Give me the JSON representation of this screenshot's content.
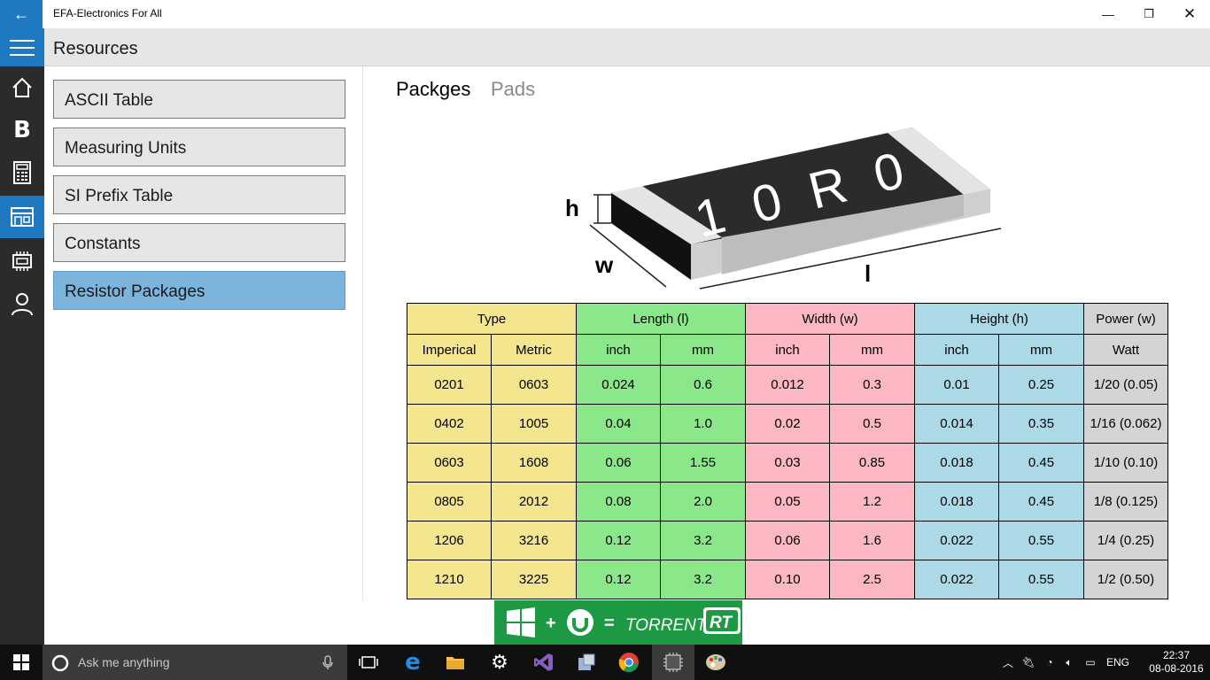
{
  "window": {
    "title": "EFA-Electronics For All"
  },
  "header": {
    "title": "Resources"
  },
  "resources": [
    {
      "label": "ASCII Table"
    },
    {
      "label": "Measuring Units"
    },
    {
      "label": "SI Prefix Table"
    },
    {
      "label": "Constants"
    },
    {
      "label": "Resistor Packages",
      "selected": true
    }
  ],
  "tabs": [
    {
      "label": "Packges",
      "selected": true
    },
    {
      "label": "Pads",
      "selected": false
    }
  ],
  "diagram": {
    "chip_text": "10R0",
    "dim_h": "h",
    "dim_w": "w",
    "dim_l": "l"
  },
  "table": {
    "groups": [
      "Type",
      "Length (l)",
      "Width (w)",
      "Height (h)",
      "Power (w)"
    ],
    "subheaders": [
      "Imperical",
      "Metric",
      "inch",
      "mm",
      "inch",
      "mm",
      "inch",
      "mm",
      "Watt"
    ],
    "rows": [
      [
        "0201",
        "0603",
        "0.024",
        "0.6",
        "0.012",
        "0.3",
        "0.01",
        "0.25",
        "1/20 (0.05)"
      ],
      [
        "0402",
        "1005",
        "0.04",
        "1.0",
        "0.02",
        "0.5",
        "0.014",
        "0.35",
        "1/16 (0.062)"
      ],
      [
        "0603",
        "1608",
        "0.06",
        "1.55",
        "0.03",
        "0.85",
        "0.018",
        "0.45",
        "1/10 (0.10)"
      ],
      [
        "0805",
        "2012",
        "0.08",
        "2.0",
        "0.05",
        "1.2",
        "0.018",
        "0.45",
        "1/8 (0.125)"
      ],
      [
        "1206",
        "3216",
        "0.12",
        "3.2",
        "0.06",
        "1.6",
        "0.022",
        "0.55",
        "1/4 (0.25)"
      ],
      [
        "1210",
        "3225",
        "0.12",
        "3.2",
        "0.10",
        "2.5",
        "0.022",
        "0.55",
        "1/2 (0.50)"
      ]
    ]
  },
  "promo": {
    "plus": "+",
    "equals": "=",
    "torrent": "TORRENT",
    "rt": "RT"
  },
  "taskbar": {
    "search_placeholder": "Ask me anything",
    "language": "ENG",
    "time": "22:37",
    "date": "08-08-2016"
  },
  "colors": {
    "accent": "#1f79c0",
    "type_col": "#f3e68f",
    "length_col": "#8be88a",
    "width_col": "#fbb7c2",
    "height_col": "#acd9e6",
    "power_col": "#d4d4d4"
  }
}
